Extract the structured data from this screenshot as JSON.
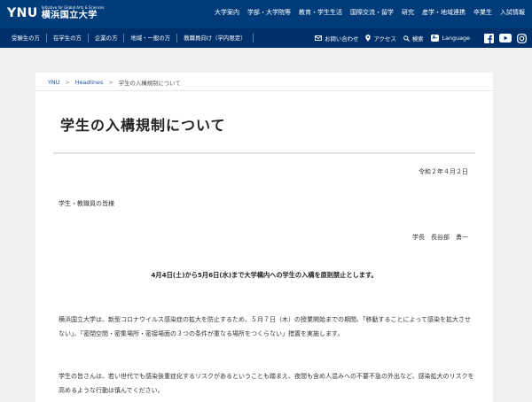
{
  "header": {
    "logo": {
      "ynu": "YNU",
      "tagline_line1": "Initiative for Global Arts & Sciences",
      "name": "横浜国立大学"
    },
    "main_nav": [
      "大学案内",
      "学部・大学院等",
      "教育・学生生活",
      "国際交流・留学",
      "研究",
      "産学・地域連携",
      "卒業生",
      "入試情報"
    ],
    "audience_nav": [
      "受験生の方",
      "在学生の方",
      "企業の方",
      "地域・一般の方",
      "教職員向け（学内限定）"
    ],
    "utilities": {
      "contact": "お問い合わせ",
      "access": "アクセス",
      "search": "検索",
      "language_badge": "A-",
      "language": "Language"
    },
    "social_icons": [
      "facebook-icon",
      "youtube-icon",
      "instagram-icon"
    ]
  },
  "breadcrumb": {
    "home": "YNU",
    "section": "Headlines",
    "current": "学生の入構規制について"
  },
  "article": {
    "title": "学生の入構規制について",
    "date": "令和２年４月２日",
    "salutation": "学生・教職員の皆様",
    "signature": "学長　長谷部　勇一",
    "headline": "4月4日(土)から5月6日(水)まで大学構内への学生の入構を原則禁止とします。",
    "paragraph1": "横浜国立大学は、新型コロナウイルス感染症の拡大を防止するため、５月７日（木）の授業開始までの期間、「移動することによって感染を拡大させない」、「密閉空間・密集場所・密接場面の３つの条件が重なる場所をつくらない」措置を実施します。",
    "paragraph2": "学生の皆さんは、若い世代でも感染後重症化するリスクがあるということも踏まえ、夜間も含め人混みへの不要不急の外出など、感染拡大のリスクを高めるような行動は慎んでください。"
  },
  "colors": {
    "header_bg": "#003b7a",
    "subnav_bg": "#00306a",
    "link": "#1a4f9c"
  }
}
